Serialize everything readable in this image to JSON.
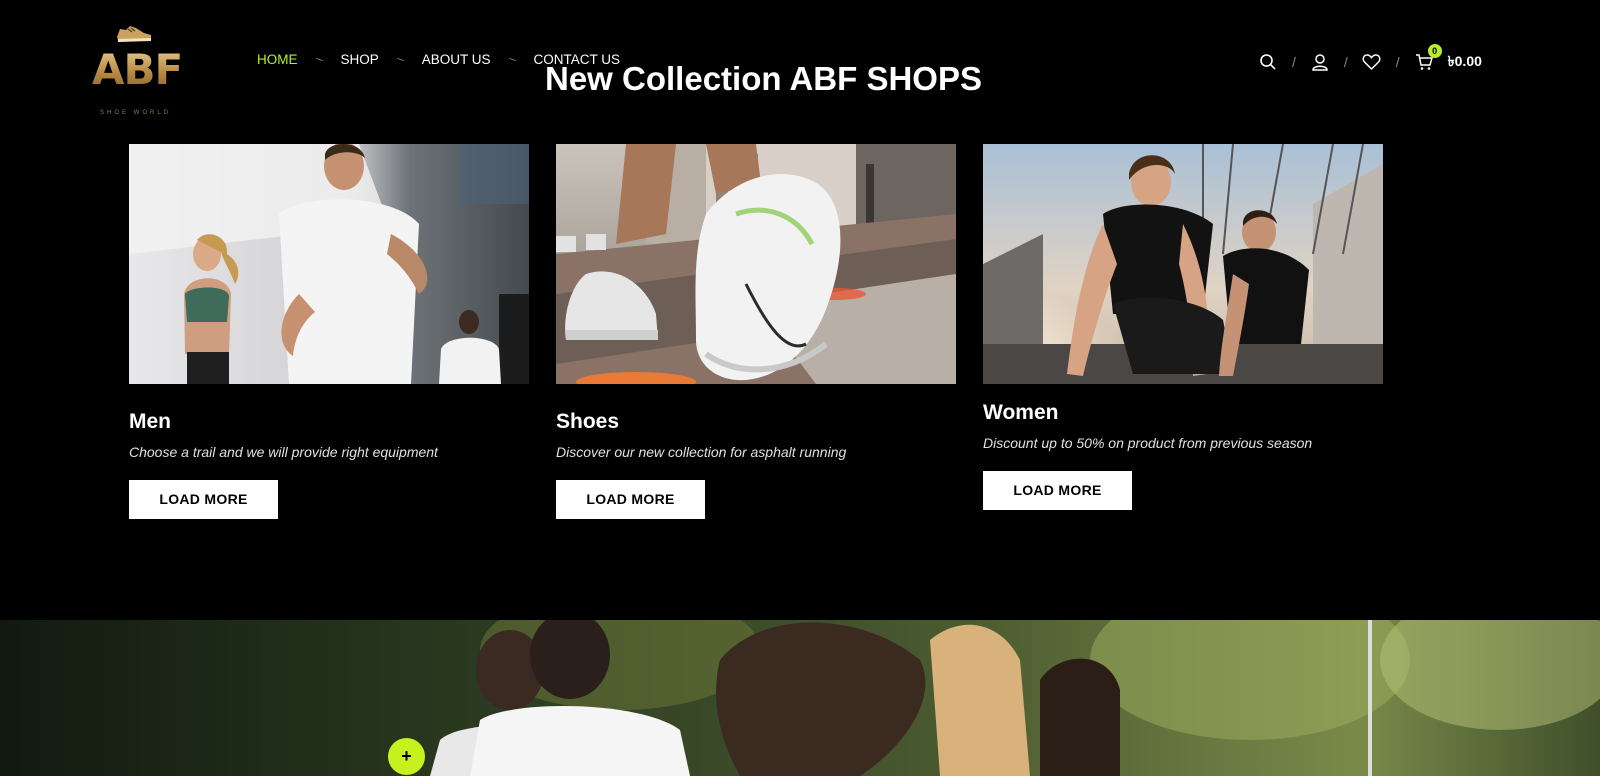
{
  "logo": {
    "text": "ABF",
    "subtitle": "SHOE WORLD"
  },
  "nav": {
    "items": [
      {
        "label": "HOME",
        "active": true
      },
      {
        "label": "SHOP",
        "active": false
      },
      {
        "label": "ABOUT US",
        "active": false
      },
      {
        "label": "CONTACT US",
        "active": false
      }
    ]
  },
  "page_title": "New Collection ABF SHOPS",
  "tools": {
    "search_icon": "search-icon",
    "account_icon": "user-icon",
    "wishlist_icon": "heart-icon",
    "cart_icon": "cart-icon",
    "cart_count": "0",
    "cart_total": "৳0.00"
  },
  "cards": [
    {
      "title": "Men",
      "description": "Choose a trail and we will provide right equipment",
      "button": "LOAD MORE"
    },
    {
      "title": "Shoes",
      "description": "Discover our new collection for asphalt running",
      "button": "LOAD MORE"
    },
    {
      "title": "Women",
      "description": "Discount up to 50% on product from previous season",
      "button": "LOAD MORE"
    }
  ],
  "fab": {
    "label": "+"
  },
  "colors": {
    "accent": "#b7ef2e",
    "background": "#000000",
    "button_bg": "#ffffff",
    "logo_gold": "#c9a25f"
  }
}
